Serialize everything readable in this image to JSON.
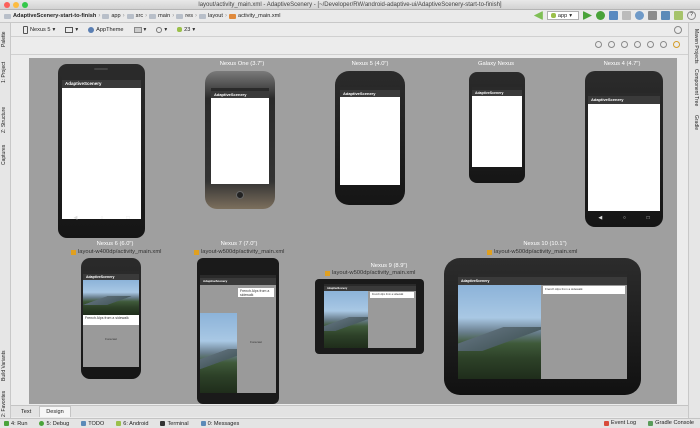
{
  "window": {
    "title": "layout/activity_main.xml - AdaptiveScenery - [~/Developer/RW/android-adaptive-ui/AdaptiveScenery-start-to-finish]"
  },
  "breadcrumbs": [
    "AdaptiveScenery-start-to-finish",
    "app",
    "src",
    "main",
    "res",
    "layout",
    "activity_main.xml"
  ],
  "run_config": "app",
  "left_tabs": [
    "1: Project",
    "Palette",
    "Z: Structure",
    "Captures",
    "Build Variants",
    "2: Favorites"
  ],
  "right_tabs": [
    "Maven Projects",
    "Component Tree",
    "Gradle"
  ],
  "toolbar": {
    "device": "Nexus 5",
    "theme": "AppTheme",
    "api": "23"
  },
  "devices": [
    {
      "label": "",
      "app_title": "AdaptiveScenery"
    },
    {
      "label": "Nexus One (3.7\")",
      "app_title": "AdaptiveScenery"
    },
    {
      "label": "Nexus 5 (4.0\")",
      "app_title": "AdaptiveScenery"
    },
    {
      "label": "Galaxy Nexus",
      "app_title": "AdaptiveScenery"
    },
    {
      "label": "Nexus 4 (4.7\")",
      "app_title": "AdaptiveScenery"
    },
    {
      "label": "Nexus 6 (6.0\")",
      "layout": "layout-w400dp/activity_main.xml",
      "app_title": "AdaptiveScenery",
      "caption": "French Alps from a sidewalk",
      "placeholder": "Forecast"
    },
    {
      "label": "Nexus 7 (7.0\")",
      "layout": "layout-w500dp/activity_main.xml",
      "app_title": "AdaptiveScenery",
      "caption": "French Alps from a sidewalk",
      "placeholder": "Forecast"
    },
    {
      "label": "Nexus 9 (8.9\")",
      "layout": "layout-w500dp/activity_main.xml",
      "app_title": "AdaptiveScenery",
      "caption": "French Alps from a sidewalk"
    },
    {
      "label": "Nexus 10 (10.1\")",
      "layout": "layout-w500dp/activity_main.xml",
      "app_title": "AdaptiveScenery",
      "caption": "French Alps from a sidewalk"
    }
  ],
  "editor_tabs": [
    "Text",
    "Design"
  ],
  "status": {
    "left": [
      "4: Run",
      "5: Debug",
      "TODO",
      "6: Android",
      "Terminal",
      "0: Messages"
    ],
    "right": [
      "Event Log",
      "Gradle Console"
    ]
  },
  "colors": {
    "canvas": "#9f9f9f",
    "action_bar": "#3a3a3a"
  }
}
